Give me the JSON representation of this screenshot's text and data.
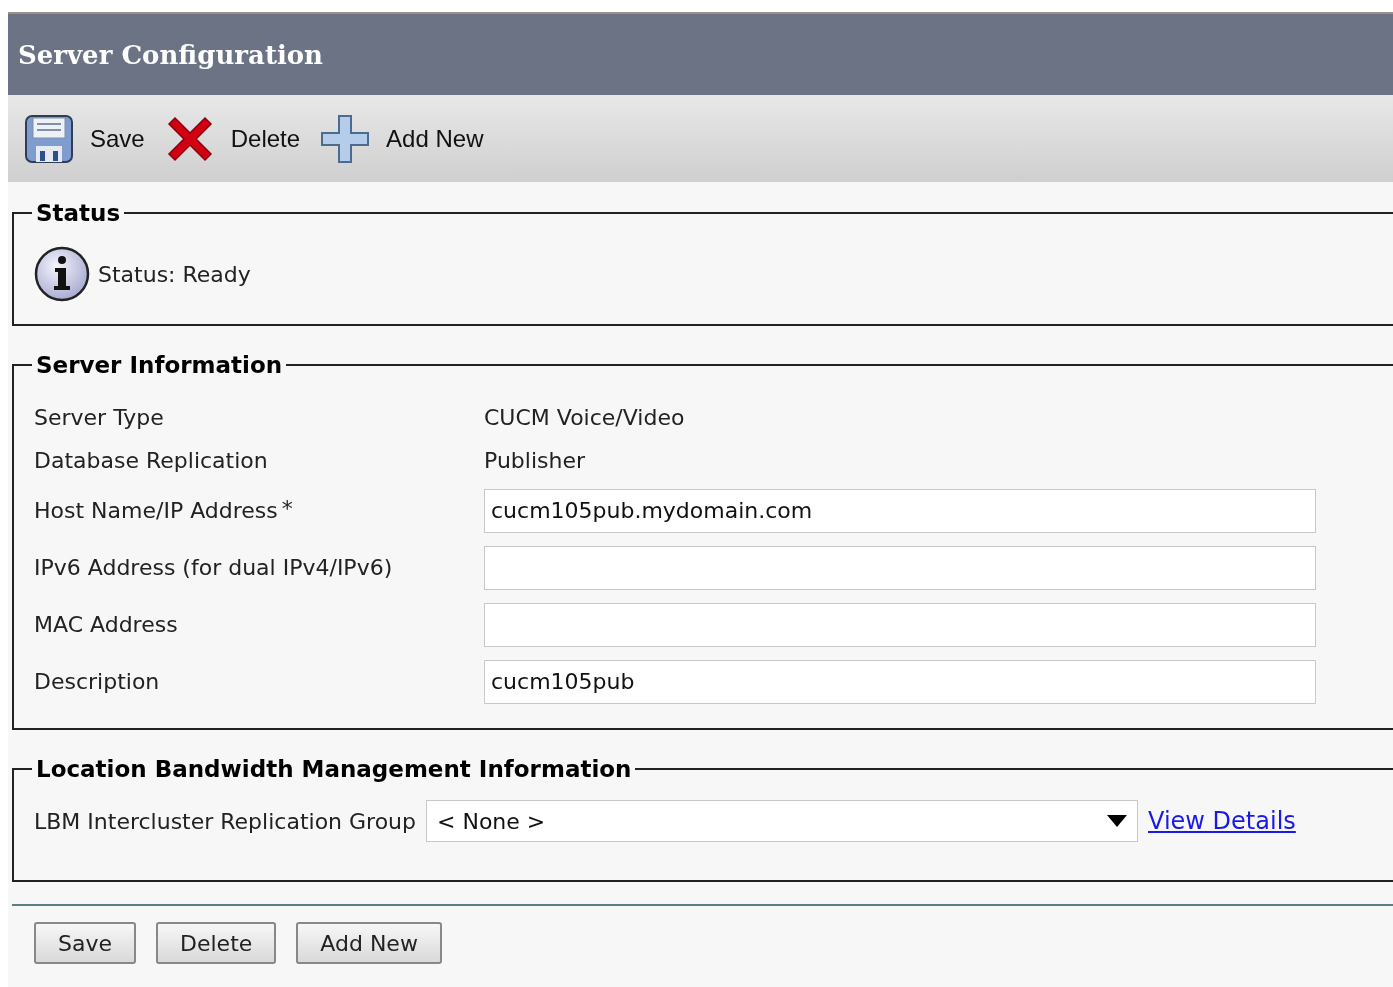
{
  "title": "Server Configuration",
  "toolbar": [
    {
      "kind": "save",
      "label": "Save"
    },
    {
      "kind": "delete",
      "label": "Delete"
    },
    {
      "kind": "add",
      "label": "Add New"
    }
  ],
  "status": {
    "legend": "Status",
    "message": "Status: Ready"
  },
  "server_information": {
    "legend": "Server Information",
    "rows": [
      {
        "kind": "text",
        "label": "Server Type",
        "value": "CUCM Voice/Video"
      },
      {
        "kind": "text",
        "label": "Database Replication",
        "value": "Publisher"
      },
      {
        "kind": "input",
        "label": "Host Name/IP Address",
        "required_mark": "*",
        "value": "cucm105pub.mydomain.com"
      },
      {
        "kind": "input",
        "label": "IPv6 Address (for dual IPv4/IPv6)"
      },
      {
        "kind": "input",
        "label": "MAC Address"
      },
      {
        "kind": "input",
        "label": "Description",
        "value": "cucm105pub"
      }
    ]
  },
  "location_bandwidth": {
    "legend": "Location Bandwidth Management Information",
    "label": "LBM Intercluster Replication Group",
    "select_value": "< None >",
    "link": "View Details"
  },
  "buttons": [
    "Save",
    "Delete",
    "Add New"
  ]
}
